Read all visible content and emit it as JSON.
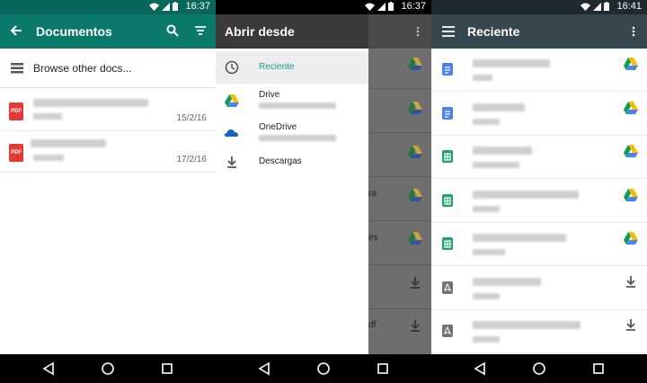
{
  "status_bar": {
    "time_1": "16:37",
    "time_2": "16:37",
    "time_3": "16:41"
  },
  "screen1": {
    "title": "Documentos",
    "browse_label": "Browse other docs...",
    "documents": [
      {
        "type_badge": "PDF",
        "date": "15/2/16"
      },
      {
        "type_badge": "PDF",
        "date": "17/2/16"
      }
    ]
  },
  "screen2": {
    "title": "Abrir desde",
    "items": [
      {
        "label": "Reciente",
        "icon": "clock-icon",
        "active": true
      },
      {
        "label": "Drive",
        "icon": "google-drive-icon"
      },
      {
        "label": "OneDrive",
        "icon": "onedrive-icon"
      },
      {
        "label": "Descargas",
        "icon": "download-icon"
      }
    ],
    "behind_fragments": [
      "ra",
      "es",
      "df"
    ]
  },
  "screen3": {
    "title": "Reciente",
    "rows": [
      {
        "file_icon": "google-docs-icon",
        "source_icon": "google-drive-icon"
      },
      {
        "file_icon": "google-docs-icon",
        "source_icon": "google-drive-icon"
      },
      {
        "file_icon": "google-sheets-icon",
        "source_icon": "google-drive-icon"
      },
      {
        "file_icon": "google-sheets-icon",
        "source_icon": "google-drive-icon"
      },
      {
        "file_icon": "google-sheets-icon",
        "source_icon": "google-drive-icon"
      },
      {
        "file_icon": "pdf-file-icon",
        "source_icon": "download-icon"
      },
      {
        "file_icon": "pdf-file-icon",
        "source_icon": "download-icon"
      }
    ]
  },
  "colors": {
    "teal_appbar": "#0b7a6c",
    "slate_appbar": "#37474f",
    "accent_teal": "#13a18d",
    "pdf_red": "#e53935",
    "docs_blue": "#4a80f0",
    "sheets_green": "#21a366"
  }
}
